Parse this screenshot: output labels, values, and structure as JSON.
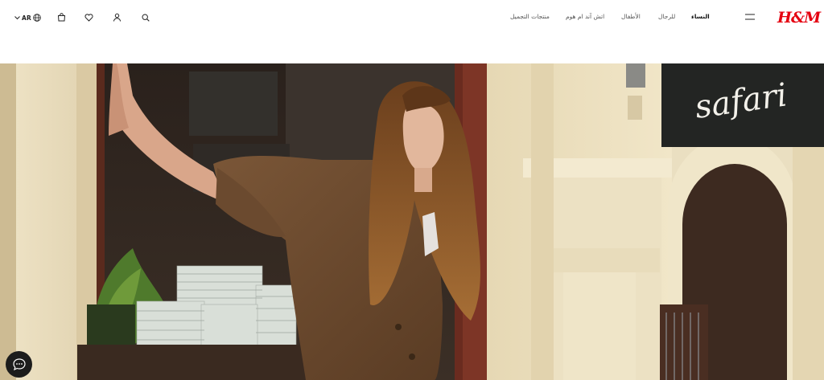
{
  "header": {
    "logo_text": "H&M",
    "language": {
      "code": "AR",
      "icon": "globe-icon",
      "chevron": "chevron-down-icon"
    },
    "icons": [
      "cart-icon",
      "heart-icon",
      "user-icon",
      "search-icon",
      "menu-icon"
    ],
    "nav": [
      {
        "label": "النساء",
        "active": true
      },
      {
        "label": "للرجال",
        "active": false
      },
      {
        "label": "الأطفال",
        "active": false
      },
      {
        "label": "اتش آند ام هوم",
        "active": false
      },
      {
        "label": "منتجات التجميل",
        "active": false
      }
    ]
  },
  "hero": {
    "sign_text": "safari",
    "description_icon": "chat-icon"
  },
  "colors": {
    "brand": "#e50010",
    "text": "#222222",
    "chat_button": "#1c1c1c"
  }
}
